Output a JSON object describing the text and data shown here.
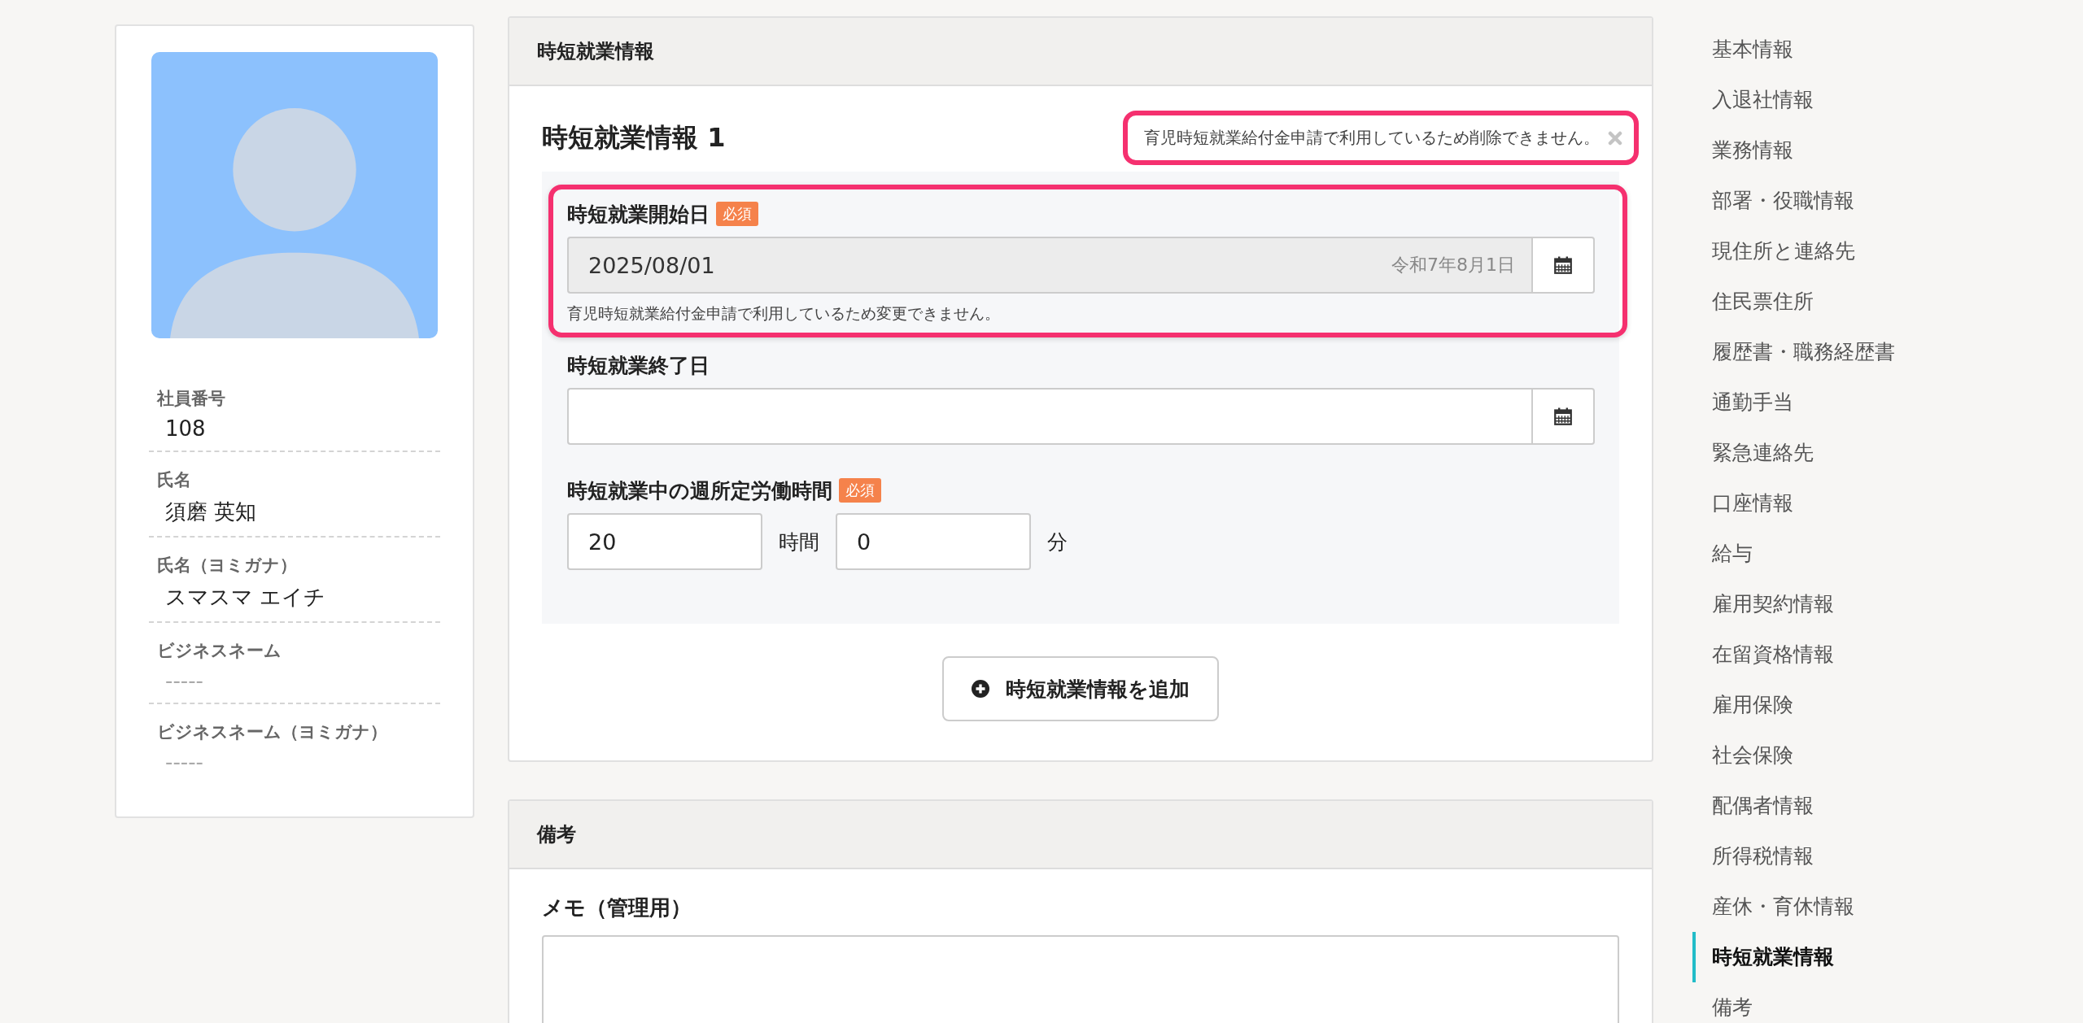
{
  "profile": {
    "fields": [
      {
        "label": "社員番号",
        "value": "108",
        "kind": "value"
      },
      {
        "label": "氏名",
        "value": "須磨 英知",
        "kind": "value"
      },
      {
        "label": "氏名（ヨミガナ）",
        "value": "スマスマ エイチ",
        "kind": "value"
      },
      {
        "label": "ビジネスネーム",
        "value": "-----",
        "kind": "empty"
      },
      {
        "label": "ビジネスネーム（ヨミガナ）",
        "value": "-----",
        "kind": "empty"
      }
    ]
  },
  "sections": [
    {
      "kind": "entries",
      "header": "時短就業情報",
      "entry_title": "時短就業情報 1",
      "delete_notice": {
        "text": "育児時短就業給付金申請で利用しているため削除できません。",
        "highlighted": true
      },
      "fields": [
        {
          "kind": "date",
          "label": "時短就業開始日",
          "required": true,
          "badge": "必須",
          "value": "2025/08/01",
          "era_date": "令和7年8月1日",
          "disabled": true,
          "help": "育児時短就業給付金申請で利用しているため変更できません。",
          "highlighted": true
        },
        {
          "kind": "date",
          "label": "時短就業終了日",
          "required": false,
          "disabled": false,
          "highlighted": false
        },
        {
          "kind": "duration",
          "label": "時短就業中の週所定労働時間",
          "required": true,
          "badge": "必須",
          "hours": "20",
          "hours_unit": "時間",
          "minutes": "0",
          "minutes_unit": "分",
          "highlighted": false
        }
      ],
      "add_button": "時短就業情報を追加"
    },
    {
      "kind": "memo",
      "header": "備考",
      "memo_label": "メモ（管理用）"
    }
  ],
  "nav": {
    "items": [
      {
        "label": "基本情報",
        "selected": false
      },
      {
        "label": "入退社情報",
        "selected": false
      },
      {
        "label": "業務情報",
        "selected": false
      },
      {
        "label": "部署・役職情報",
        "selected": false
      },
      {
        "label": "現住所と連絡先",
        "selected": false
      },
      {
        "label": "住民票住所",
        "selected": false
      },
      {
        "label": "履歴書・職務経歴書",
        "selected": false
      },
      {
        "label": "通勤手当",
        "selected": false
      },
      {
        "label": "緊急連絡先",
        "selected": false
      },
      {
        "label": "口座情報",
        "selected": false
      },
      {
        "label": "給与",
        "selected": false
      },
      {
        "label": "雇用契約情報",
        "selected": false
      },
      {
        "label": "在留資格情報",
        "selected": false
      },
      {
        "label": "雇用保険",
        "selected": false
      },
      {
        "label": "社会保険",
        "selected": false
      },
      {
        "label": "配偶者情報",
        "selected": false
      },
      {
        "label": "所得税情報",
        "selected": false
      },
      {
        "label": "産休・育休情報",
        "selected": false
      },
      {
        "label": "時短就業情報",
        "selected": true
      },
      {
        "label": "備考",
        "selected": false
      }
    ]
  }
}
